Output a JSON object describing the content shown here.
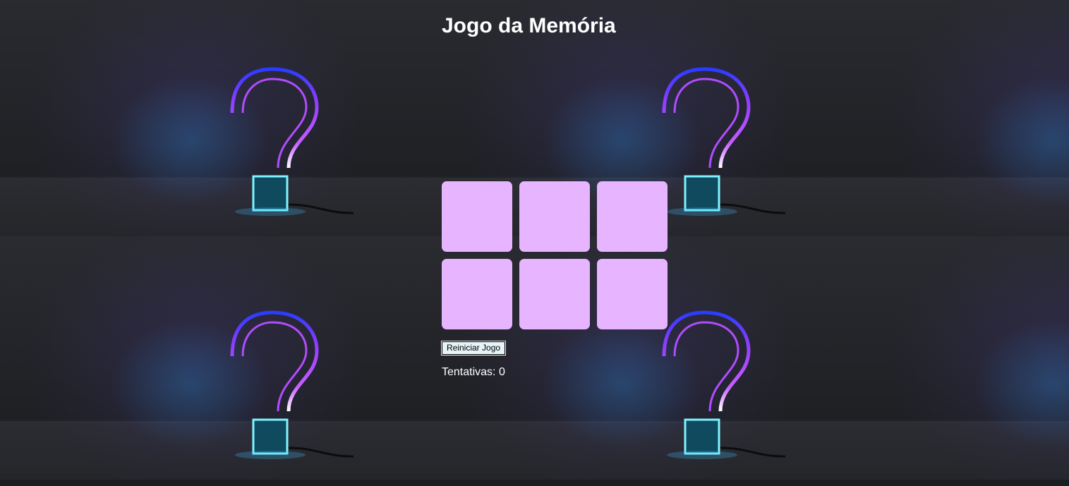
{
  "game": {
    "title": "Jogo da Memória",
    "restart_label": "Reiniciar Jogo",
    "attempts_label": "Tentativas:",
    "attempts_value": "0",
    "cards": [
      {
        "state": "face-down"
      },
      {
        "state": "face-down"
      },
      {
        "state": "face-down"
      },
      {
        "state": "face-down"
      },
      {
        "state": "face-down"
      },
      {
        "state": "face-down"
      }
    ]
  },
  "background": {
    "image": "neon-question-mark-on-pedestal",
    "tiles": 4
  },
  "colors": {
    "card_back": "#e7b4ff",
    "text": "#ffffff",
    "button_bg": "#e6f4f8",
    "page_bg": "#1c1d20"
  }
}
